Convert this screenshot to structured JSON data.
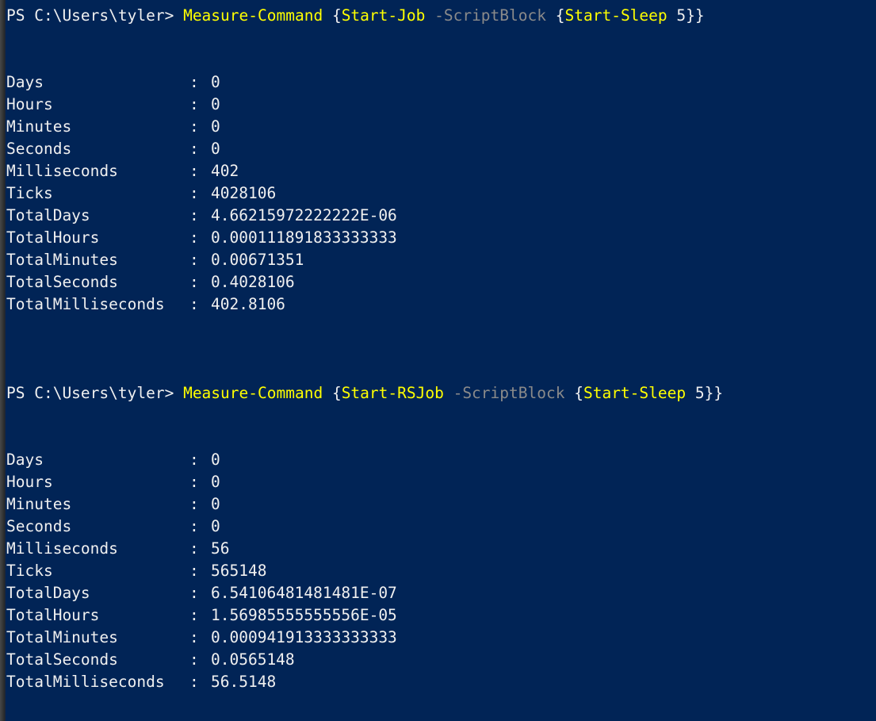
{
  "terminal": {
    "background_color": "#012456",
    "foreground_color": "#f0f0f0",
    "cmdlet_color": "#ffff00",
    "parameter_color": "#8a8a8a",
    "prompt": "PS C:\\Users\\tyler>"
  },
  "blocks": [
    {
      "command": {
        "prompt": "PS C:\\Users\\tyler>",
        "cmdlet": "Measure-Command",
        "open_brace": "{",
        "inner_cmdlet": "Start-Job",
        "parameter": "-ScriptBlock",
        "inner_open_brace": "{",
        "script_cmdlet": "Start-Sleep",
        "script_argument": "5",
        "close_braces": "}}"
      },
      "properties": [
        {
          "name": "Days",
          "separator": ":",
          "value": "0"
        },
        {
          "name": "Hours",
          "separator": ":",
          "value": "0"
        },
        {
          "name": "Minutes",
          "separator": ":",
          "value": "0"
        },
        {
          "name": "Seconds",
          "separator": ":",
          "value": "0"
        },
        {
          "name": "Milliseconds",
          "separator": ":",
          "value": "402"
        },
        {
          "name": "Ticks",
          "separator": ":",
          "value": "4028106"
        },
        {
          "name": "TotalDays",
          "separator": ":",
          "value": "4.66215972222222E-06"
        },
        {
          "name": "TotalHours",
          "separator": ":",
          "value": "0.000111891833333333"
        },
        {
          "name": "TotalMinutes",
          "separator": ":",
          "value": "0.00671351"
        },
        {
          "name": "TotalSeconds",
          "separator": ":",
          "value": "0.4028106"
        },
        {
          "name": "TotalMilliseconds",
          "separator": ":",
          "value": "402.8106"
        }
      ]
    },
    {
      "command": {
        "prompt": "PS C:\\Users\\tyler>",
        "cmdlet": "Measure-Command",
        "open_brace": "{",
        "inner_cmdlet": "Start-RSJob",
        "parameter": "-ScriptBlock",
        "inner_open_brace": "{",
        "script_cmdlet": "Start-Sleep",
        "script_argument": "5",
        "close_braces": "}}"
      },
      "properties": [
        {
          "name": "Days",
          "separator": ":",
          "value": "0"
        },
        {
          "name": "Hours",
          "separator": ":",
          "value": "0"
        },
        {
          "name": "Minutes",
          "separator": ":",
          "value": "0"
        },
        {
          "name": "Seconds",
          "separator": ":",
          "value": "0"
        },
        {
          "name": "Milliseconds",
          "separator": ":",
          "value": "56"
        },
        {
          "name": "Ticks",
          "separator": ":",
          "value": "565148"
        },
        {
          "name": "TotalDays",
          "separator": ":",
          "value": "6.54106481481481E-07"
        },
        {
          "name": "TotalHours",
          "separator": ":",
          "value": "1.56985555555556E-05"
        },
        {
          "name": "TotalMinutes",
          "separator": ":",
          "value": "0.000941913333333333"
        },
        {
          "name": "TotalSeconds",
          "separator": ":",
          "value": "0.0565148"
        },
        {
          "name": "TotalMilliseconds",
          "separator": ":",
          "value": "56.5148"
        }
      ]
    }
  ]
}
